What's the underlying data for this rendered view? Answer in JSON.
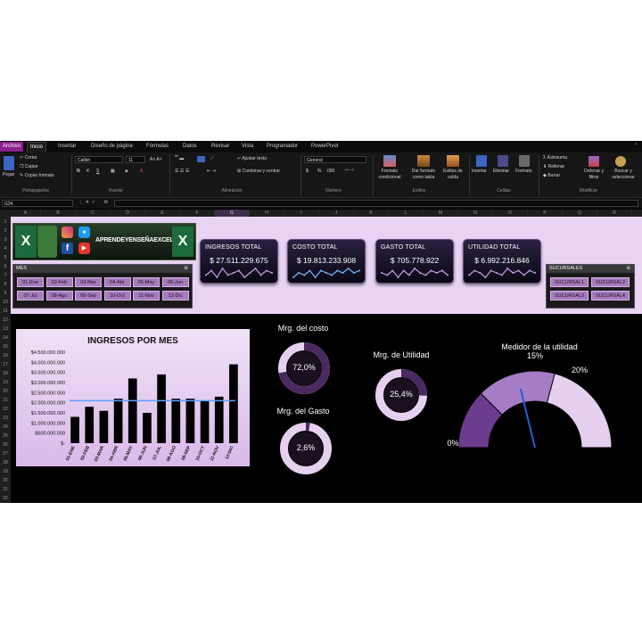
{
  "tabs": [
    "Archivo",
    "Inicio",
    "Insertar",
    "Diseño de página",
    "Fórmulas",
    "Datos",
    "Revisar",
    "Vista",
    "Programador",
    "PowerPivot"
  ],
  "ribbon": {
    "paste": "Pegar",
    "cut": "Cortar",
    "copy": "Copiar",
    "copy_format": "Copiar formato",
    "font_name": "Calibri",
    "font_size": "11",
    "bold": "N",
    "italic": "K",
    "underline": "S",
    "wrap_text": "Ajustar texto",
    "merge_center": "Combinar y centrar",
    "number_format": "General",
    "currency": "$",
    "percent": "%",
    "thousands": "000",
    "conditional_format": "Formato condicional",
    "format_table": "Dar formato como tabla",
    "cell_styles": "Estilos de celda",
    "insert": "Insertar",
    "delete": "Eliminar",
    "format": "Formato",
    "autosum": "Autosuma",
    "fill": "Rellenar",
    "clear": "Borrar",
    "sort_filter": "Ordenar y filtrar",
    "find_select": "Buscar y seleccionar",
    "groups": [
      "Portapapeles",
      "Fuente",
      "Alineación",
      "Número",
      "Estilos",
      "Celdas",
      "Modificar"
    ]
  },
  "formula_bar": {
    "name_box": "G34",
    "fx": "fx",
    "value": ""
  },
  "columns": [
    "A",
    "B",
    "C",
    "D",
    "E",
    "F",
    "G",
    "H",
    "I",
    "J",
    "K",
    "L",
    "M",
    "N",
    "O",
    "P",
    "Q",
    "R"
  ],
  "selected_column": "G",
  "rows": [
    "1",
    "2",
    "3",
    "4",
    "5",
    "6",
    "7",
    "8",
    "9",
    "10",
    "11",
    "12",
    "13",
    "14",
    "15",
    "16",
    "17",
    "18",
    "19",
    "20",
    "21",
    "22",
    "23",
    "24",
    "25",
    "26",
    "27",
    "28",
    "29",
    "30",
    "31",
    "32"
  ],
  "banner": {
    "text": "APRENDEYENSEÑAEXCEL"
  },
  "kpis": [
    {
      "title": "INGRESOS TOTAL",
      "value": "$ 27.511.229.675"
    },
    {
      "title": "COSTO TOTAL",
      "value": "$ 19.813.233.908"
    },
    {
      "title": "GASTO TOTAL",
      "value": "$ 705.778.922"
    },
    {
      "title": "UTILIDAD TOTAL",
      "value": "$ 6.992.216.846"
    }
  ],
  "sparklines": [
    [
      4,
      6,
      3,
      7,
      4,
      5,
      6,
      3,
      5,
      7,
      4,
      6,
      5
    ],
    [
      3,
      5,
      4,
      6,
      3,
      6,
      5,
      4,
      6,
      5,
      7,
      5,
      6
    ],
    [
      5,
      4,
      6,
      3,
      6,
      4,
      7,
      5,
      4,
      6,
      5,
      6,
      4
    ],
    [
      4,
      6,
      5,
      3,
      6,
      5,
      4,
      7,
      5,
      6,
      4,
      6,
      5
    ]
  ],
  "colors": {
    "accent": "#8e1f8f",
    "lavender": "#e9d3f3",
    "bar": "#000000",
    "avgline": "#5aa0ff",
    "gauge_dark": "#6c3d8f",
    "gauge_mid": "#a57cc5",
    "gauge_light": "#e6d0f0",
    "needle": "#1f5fd6"
  },
  "mes_panel": {
    "title": "MES",
    "months": [
      "01-Ene",
      "02-Feb",
      "03-Mar",
      "04-Abr",
      "05-May",
      "06-Jun",
      "07-Jul",
      "08-Ago",
      "09-Sep",
      "10-Oct",
      "11-Nov",
      "12-Dic"
    ]
  },
  "sucursales_panel": {
    "title": "SUCURSALES",
    "items": [
      "SUCURSAL1",
      "SUCURSAL2",
      "SUCURSAL3",
      "SUCURSAL4"
    ]
  },
  "chart_data": {
    "type": "bar",
    "title": "INGRESOS POR MES",
    "categories": [
      "01-ENE",
      "02-FEB",
      "03-MAR",
      "04-ABR",
      "05-MAY",
      "06-JUN",
      "07-JUL",
      "08-AGO",
      "09-SEP",
      "10-OCT",
      "11-NOV",
      "12-DIC"
    ],
    "values": [
      1300000000,
      1800000000,
      1600000000,
      2200000000,
      3200000000,
      1500000000,
      3400000000,
      2200000000,
      2200000000,
      2100000000,
      2300000000,
      3900000000
    ],
    "average": 2100000000,
    "ylim": [
      0,
      4500000000
    ],
    "yticks": [
      "$4.500.000.000",
      "$4.000.000.000",
      "$3.500.000.000",
      "$3.000.000.000",
      "$2.500.000.000",
      "$2.000.000.000",
      "$1.500.000.000",
      "$1.000.000.000",
      "$500.000.000",
      "$-"
    ],
    "xlabel": "",
    "ylabel": ""
  },
  "rings": [
    {
      "title": "Mrg. del costo",
      "value": "72,0%",
      "pct": 0.72
    },
    {
      "title": "Mrg. de Utilidad",
      "value": "25,4%",
      "pct": 0.254
    },
    {
      "title": "Mrg. del Gasto",
      "value": "2,6%",
      "pct": 0.026
    }
  ],
  "gauge": {
    "title": "Medidor de la utilidad",
    "labels": [
      "0%",
      "15%",
      "20%"
    ],
    "bands": [
      0.15,
      0.2,
      0.25
    ],
    "needle_pct": 0.254
  }
}
